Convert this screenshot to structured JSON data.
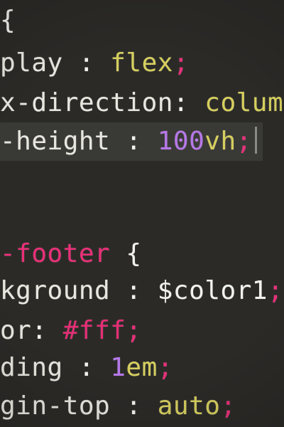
{
  "colors": {
    "background": "#2b2a27",
    "active_line": "#393936",
    "property": "#e7e7df",
    "selector": "#ea2f78",
    "keyword_value": "#d6cf5e",
    "number": "#b677e8",
    "semicolon": "#e8307a",
    "hex_color": "#e52d75"
  },
  "code_lines": [
    {
      "segments": [
        {
          "text": "{",
          "kind": "punc"
        }
      ]
    },
    {
      "segments": [
        {
          "text": "play",
          "kind": "prop"
        },
        {
          "text": " : ",
          "kind": "punc"
        },
        {
          "text": "flex",
          "kind": "val"
        },
        {
          "text": ";",
          "kind": "semi"
        }
      ]
    },
    {
      "segments": [
        {
          "text": "x-direction",
          "kind": "prop"
        },
        {
          "text": ": ",
          "kind": "punc"
        },
        {
          "text": "colum",
          "kind": "val"
        }
      ]
    },
    {
      "segments": [
        {
          "text": "-height",
          "kind": "prop"
        },
        {
          "text": " : ",
          "kind": "punc"
        },
        {
          "text": "100",
          "kind": "num"
        },
        {
          "text": "vh",
          "kind": "unit"
        },
        {
          "text": ";",
          "kind": "semi"
        }
      ],
      "active": true,
      "caret": true
    },
    {
      "segments": []
    },
    {
      "segments": []
    },
    {
      "segments": [
        {
          "text": "-footer",
          "kind": "sel"
        },
        {
          "text": " {",
          "kind": "punc"
        }
      ]
    },
    {
      "segments": [
        {
          "text": "kground",
          "kind": "prop"
        },
        {
          "text": " : ",
          "kind": "punc"
        },
        {
          "text": "$color1",
          "kind": "var"
        },
        {
          "text": ";",
          "kind": "semi"
        }
      ]
    },
    {
      "segments": [
        {
          "text": "or",
          "kind": "prop"
        },
        {
          "text": ": ",
          "kind": "punc"
        },
        {
          "text": "#fff",
          "kind": "hex"
        },
        {
          "text": ";",
          "kind": "semi"
        }
      ]
    },
    {
      "segments": [
        {
          "text": "ding",
          "kind": "prop"
        },
        {
          "text": " : ",
          "kind": "punc"
        },
        {
          "text": "1",
          "kind": "num"
        },
        {
          "text": "em",
          "kind": "unit"
        },
        {
          "text": ";",
          "kind": "semi"
        }
      ]
    },
    {
      "segments": [
        {
          "text": "gin-top",
          "kind": "prop"
        },
        {
          "text": " : ",
          "kind": "punc"
        },
        {
          "text": "auto",
          "kind": "val"
        },
        {
          "text": ";",
          "kind": "semi"
        }
      ]
    }
  ]
}
